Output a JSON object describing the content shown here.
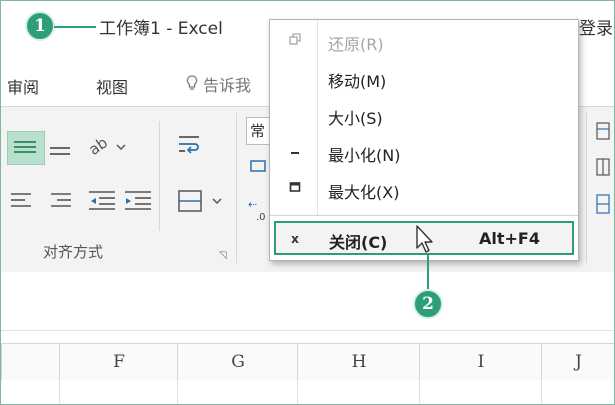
{
  "titlebar": {
    "callout_1": "1",
    "doc_title": "工作簿1 - Excel",
    "login": "登录"
  },
  "ribbon_tabs": {
    "review": "审阅",
    "view": "视图",
    "tell_me": "告诉我"
  },
  "ribbon": {
    "alignment_group_label": "对齐方式",
    "number_format_value": "常规",
    "decimal_glyph": ".0"
  },
  "window_menu": {
    "items": [
      {
        "label": "还原(R)",
        "icon": "restore-icon",
        "enabled": false
      },
      {
        "label": "移动(M)",
        "icon": "",
        "enabled": true
      },
      {
        "label": "大小(S)",
        "icon": "",
        "enabled": true
      },
      {
        "label": "最小化(N)",
        "icon": "minimize-icon",
        "enabled": true
      },
      {
        "label": "最大化(X)",
        "icon": "maximize-icon",
        "enabled": true
      }
    ],
    "close": {
      "label": "关闭(C)",
      "icon_glyph": "x",
      "shortcut": "Alt+F4"
    }
  },
  "callout_2": "2",
  "columns": [
    "F",
    "G",
    "H",
    "I",
    "J"
  ],
  "colors": {
    "accent": "#2e9e77",
    "selection": "#b9dfcd"
  }
}
